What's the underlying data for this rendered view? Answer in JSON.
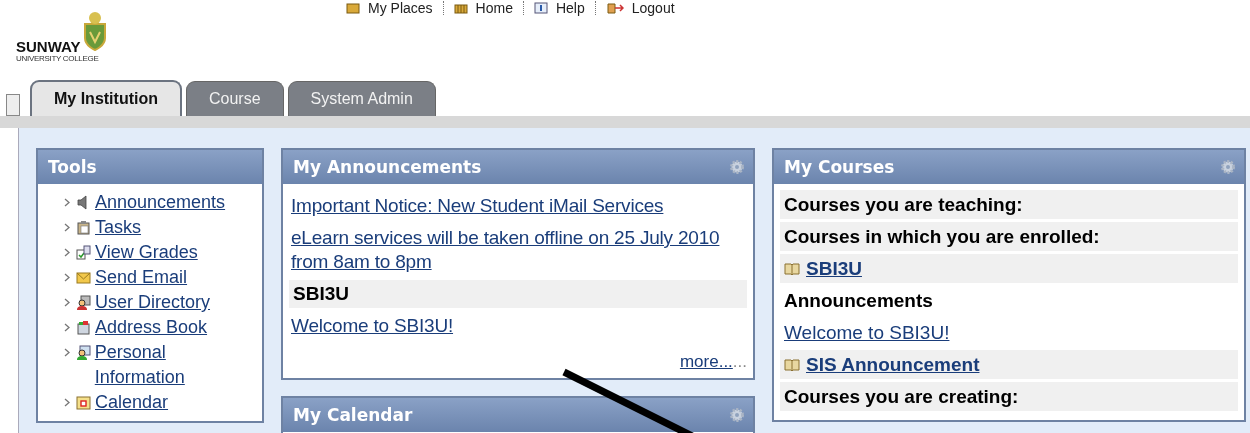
{
  "header": {
    "logo": {
      "name": "SUNWAY",
      "subtitle": "UNIVERSITY COLLEGE"
    },
    "nav": [
      {
        "label": "My Places"
      },
      {
        "label": "Home"
      },
      {
        "label": "Help"
      },
      {
        "label": "Logout"
      }
    ]
  },
  "tabs": [
    {
      "label": "My Institution",
      "selected": true
    },
    {
      "label": "Course",
      "selected": false
    },
    {
      "label": "System Admin",
      "selected": false
    }
  ],
  "tools": {
    "title": "Tools",
    "items": [
      {
        "label": "Announcements"
      },
      {
        "label": "Tasks"
      },
      {
        "label": "View Grades"
      },
      {
        "label": "Send Email"
      },
      {
        "label": "User Directory"
      },
      {
        "label": "Address Book"
      },
      {
        "label": "Personal Information"
      },
      {
        "label": "Calendar"
      }
    ]
  },
  "announcements": {
    "title": "My Announcements",
    "items": [
      {
        "kind": "link",
        "text": "Important Notice: New Student iMail Services"
      },
      {
        "kind": "link",
        "text": "eLearn services will be taken offline on 25 July 2010 from 8am to 8pm"
      },
      {
        "kind": "group",
        "text": "SBI3U"
      },
      {
        "kind": "link",
        "text": "Welcome to SBI3U!"
      }
    ],
    "more": "more...",
    "dots": "..."
  },
  "calendar": {
    "title": "My Calendar"
  },
  "courses": {
    "title": "My Courses",
    "rows": [
      {
        "kind": "header",
        "text": "Courses you are teaching:"
      },
      {
        "kind": "header",
        "text": "Courses in which you are enrolled:"
      },
      {
        "kind": "course",
        "text": "SBI3U"
      },
      {
        "kind": "heading",
        "text": "Announcements"
      },
      {
        "kind": "link",
        "text": "Welcome to SBI3U!"
      },
      {
        "kind": "course",
        "text": "SIS Announcement"
      },
      {
        "kind": "header",
        "text": "Courses you are creating:"
      }
    ]
  }
}
